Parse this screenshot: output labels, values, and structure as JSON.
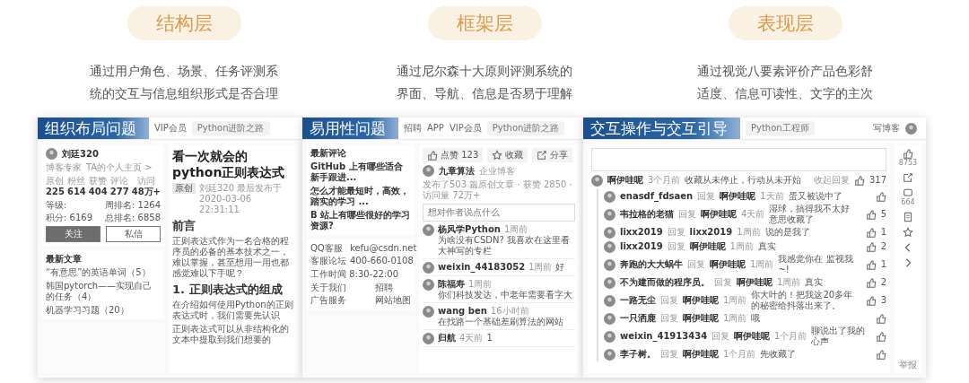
{
  "sections": [
    {
      "label": "结构层",
      "description": [
        "通过用户角色、场景、任务评测系",
        "统的交互与信息组织形式是否合理"
      ]
    },
    {
      "label": "框架层",
      "description": [
        "通过尼尔森十大原则评测系统的",
        "界面、导航、信息是否易于理解"
      ]
    },
    {
      "label": "表现层",
      "description": [
        "通过视觉八要素评价产品色彩舒",
        "适度、信息可读性、文字的主次"
      ]
    }
  ],
  "panels": [
    {
      "kind": "article",
      "title": "组织布局问题",
      "nav": [
        "VIP会员"
      ],
      "search": "Python进阶之路",
      "profile": {
        "name": "刘廷320",
        "tag": "博客专家",
        "link": "TA的个人主页 >"
      },
      "stats": [
        {
          "label": "原创",
          "value": "225"
        },
        {
          "label": "粉丝",
          "value": "614"
        },
        {
          "label": "获赞",
          "value": "404"
        },
        {
          "label": "评论",
          "value": "277"
        },
        {
          "label": "访问",
          "value": "48万+"
        }
      ],
      "ranks": [
        "等级:",
        "周排名: 1264",
        "积分: 6169",
        "总排名: 6858"
      ],
      "buttons": [
        "关注",
        "私信"
      ],
      "recent_title": "最新文章",
      "recent": [
        "“有意思”的英语单词（5）",
        "韩国pytorch——实现自己的任务（4）",
        "机器学习习题（20）"
      ],
      "article": {
        "heading": "看一次就会的python正则表达式",
        "tag": "原创",
        "meta": "刘廷320  最后发布于2020-03-06 22:31:11",
        "sections": [
          {
            "heading": "前言",
            "paragraphs": [
              "正则表达式作为一名合格的程序员的必备的基本技术之一，难以掌握，甚至想用一用也都感觉难以下手呢？"
            ]
          },
          {
            "heading": "1. 正则表达式的组成",
            "paragraphs": [
              "在介绍如何使用Python的正则表达式时，我们需要先认识",
              "正则表达式可以从非结构化的文本中提取到我们想要的"
            ]
          }
        ]
      }
    },
    {
      "kind": "comments",
      "title": "易用性问题",
      "nav": [
        "招聘",
        "APP",
        "VIP会员"
      ],
      "search": "Python进阶之路",
      "latest_title": "最新评论",
      "latest": [
        "GitHub 上有哪些适合新手跟进...",
        "怎么才能最短时，高效，踏实的学习 ...",
        "B 站上有哪些很好的学习资源?"
      ],
      "contacts": [
        "QQ客服",
        "kefu@csdn.net",
        "客服论坛",
        "400-660-0108"
      ],
      "hours": "工作时间 8:30-22:00",
      "links": [
        "关于我们",
        "招聘",
        "广告服务",
        "网站地图"
      ],
      "actions": [
        {
          "kind": "like",
          "label": "点赞 123"
        },
        {
          "kind": "star",
          "label": "收藏"
        },
        {
          "kind": "share",
          "label": "分享"
        }
      ],
      "author": {
        "name": "九章算法",
        "tag": "企业博客",
        "meta": "发布了503 篇原创文章 · 获赞 2850 · 访问量 72万+"
      },
      "placeholder": "想对作者说点什么",
      "comments": [
        {
          "user": "杨风学Python",
          "time": "1周前",
          "text": "为啥没有CSDN? 我喜欢在这里看大神写的专栏"
        },
        {
          "user": "weixin_44183052",
          "time": "1周前",
          "text": "好"
        },
        {
          "user": "陈福寿",
          "time": "1周前",
          "text": "你们科技发达，中老年需要看字大"
        },
        {
          "user": "wang ben",
          "time": "16小时前",
          "text": "在找路一个基础差刷算法的网站"
        },
        {
          "user": "归航",
          "time": "4天前",
          "text": "1"
        }
      ]
    },
    {
      "kind": "replies",
      "title": "交互操作与交互引导",
      "search": "Python工程师",
      "write": "写博客",
      "main": {
        "user": "啊伊哇呢",
        "time": "3个月前",
        "text": "收藏从未停止，行动从未开始",
        "collapse": "收起回复",
        "likes": "317"
      },
      "replies": [
        {
          "user": "enasdf_fdsaen",
          "action": "回复",
          "target": "啊伊哇呢",
          "time": "1天前",
          "text": "蛋又被说中了"
        },
        {
          "user": "韦拉格的老猫",
          "action": "回复",
          "target": "啊伊哇呢",
          "time": "4天前",
          "text": "湿球，搞得我不太好意思收藏了",
          "likes": "5"
        },
        {
          "user": "lixx2019",
          "action": "回复",
          "target": "lixx2019",
          "time": "1周前",
          "text": "说的是我了",
          "likes": "1"
        },
        {
          "user": "lixx2019",
          "action": "回复",
          "target": "啊伊哇呢",
          "time": "1周前",
          "text": "真实",
          "likes": "2"
        },
        {
          "user": "奔跑的大大蜗牛",
          "action": "回复",
          "target": "啊伊哇呢",
          "time": "1周前",
          "text": "我感觉你在 监视我~!",
          "likes": "1"
        },
        {
          "user": "不为建而做的程序员。",
          "action": "回复",
          "target": "啊伊哇呢",
          "time": "1周前",
          "text": "真实",
          "likes": "2"
        },
        {
          "user": "一路无尘",
          "action": "回复",
          "target": "啊伊哇呢",
          "time": "1周前",
          "text": "你大叶的！把我这20多年的秘密给抖落出来了。",
          "likes": "3"
        },
        {
          "user": "一只洒鹿",
          "action": "回复",
          "target": "啊伊哇呢",
          "time": "1周前",
          "text": "哦"
        },
        {
          "user": "weixin_41913434",
          "action": "回复",
          "target": "啊伊哇呢",
          "time": "1个月前",
          "text": "聊说出了我的心声"
        },
        {
          "user": "李子树。",
          "action": "回复",
          "target": "啊伊哇呢",
          "time": "1个月前",
          "text": "先收藏了"
        }
      ],
      "rail": [
        {
          "kind": "like",
          "count": "8753"
        },
        {
          "kind": "share"
        },
        {
          "kind": "comment",
          "count": "664"
        },
        {
          "kind": "doc"
        },
        {
          "kind": "star"
        },
        {
          "kind": "prev"
        },
        {
          "kind": "next"
        }
      ],
      "report": "举报"
    }
  ]
}
